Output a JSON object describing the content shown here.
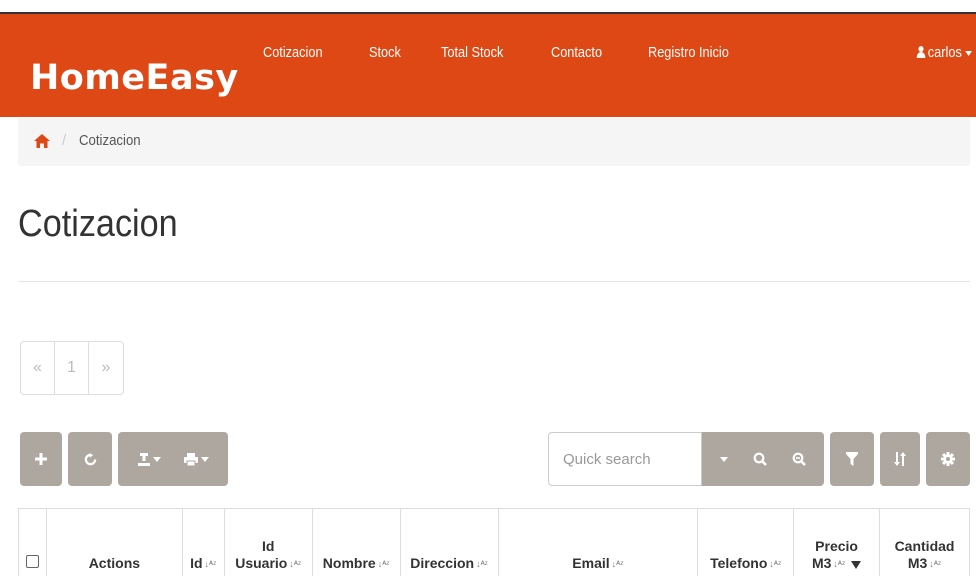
{
  "navbar": {
    "brand": "HomeEasy",
    "items": [
      "Cotizacion",
      "Stock",
      "Total Stock",
      "Contacto",
      "Registro Inicio"
    ],
    "user": "carlos",
    "color": "#dd4814"
  },
  "breadcrumb": {
    "home_icon": "home-icon",
    "separator": "/",
    "current": "Cotizacion"
  },
  "page": {
    "title": "Cotizacion"
  },
  "pagination": {
    "prev": "«",
    "page": "1",
    "next": "»"
  },
  "toolbar": {
    "button_color": "#aea79f",
    "add_icon": "plus-icon",
    "refresh_icon": "refresh-icon",
    "export_icon": "export-icon",
    "print_icon": "print-icon",
    "search_placeholder": "Quick search",
    "search_value": "",
    "filter_icon": "filter-icon",
    "sort_icon": "sort-icon",
    "settings_icon": "gear-icon"
  },
  "table": {
    "columns": [
      {
        "line1": "",
        "line2": "",
        "sortable": false
      },
      {
        "line1": "",
        "line2": "Actions",
        "sortable": false
      },
      {
        "line1": "",
        "line2": "Id",
        "sortable": true
      },
      {
        "line1": "Id",
        "line2": "Usuario",
        "sortable": true
      },
      {
        "line1": "",
        "line2": "Nombre",
        "sortable": true
      },
      {
        "line1": "",
        "line2": "Direccion",
        "sortable": true
      },
      {
        "line1": "",
        "line2": "Email",
        "sortable": true
      },
      {
        "line1": "",
        "line2": "Telefono",
        "sortable": true
      },
      {
        "line1": "Precio",
        "line2": "M3",
        "sortable": true
      },
      {
        "line1": "Cantidad",
        "line2": "M3",
        "sortable": true
      }
    ]
  }
}
